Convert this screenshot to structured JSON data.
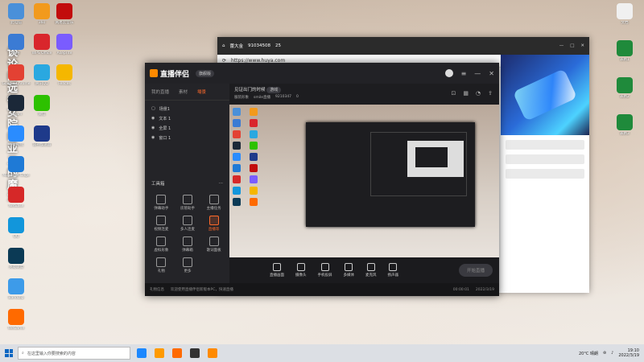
{
  "desktop": {
    "vertical_text": "谈论的远征女院的亚二的魔法",
    "icons_left": [
      {
        "label": "此电脑",
        "color": "#4a90d9"
      },
      {
        "label": "网络",
        "color": "#3b7bd4"
      },
      {
        "label": "Google Chrome",
        "color": "#e34133"
      },
      {
        "label": "Steam",
        "color": "#1b2838"
      },
      {
        "label": "百度网盘",
        "color": "#2a8cff"
      },
      {
        "label": "Microsoft Edge",
        "color": "#1f7ad6"
      },
      {
        "label": "NetEase",
        "color": "#d62828"
      },
      {
        "label": "QQ",
        "color": "#1296db"
      },
      {
        "label": "英雄联盟",
        "color": "#0b3a55"
      },
      {
        "label": "Bandizip",
        "color": "#3d9be9"
      },
      {
        "label": "WeGame",
        "color": "#ff6a00"
      }
    ],
    "icons_col2": [
      {
        "label": "360",
        "color": "#f29a1d"
      },
      {
        "label": "WPS Office",
        "color": "#d9262c"
      },
      {
        "label": "腾讯QQ",
        "color": "#2aa8e0"
      },
      {
        "label": "微信",
        "color": "#2dc100"
      },
      {
        "label": "雷神加速器",
        "color": "#1e3a8a"
      }
    ],
    "icons_col3": [
      {
        "label": "网易云音乐",
        "color": "#c20c0c"
      },
      {
        "label": "Aseprite",
        "color": "#7a5cff"
      },
      {
        "label": "Fences",
        "color": "#f5b700"
      }
    ],
    "icons_right": [
      {
        "label": "文档",
        "color": "#f0f0f0"
      },
      {
        "label": "表格1",
        "color": "#1f8a3b"
      },
      {
        "label": "表格2",
        "color": "#1f8a3b"
      },
      {
        "label": "表格3",
        "color": "#1f8a3b"
      }
    ]
  },
  "back_window": {
    "room_name": "蕾大金",
    "room_id": "91034508",
    "viewers": "25",
    "address": "https://www.huya.com"
  },
  "app": {
    "title": "直播伴侣",
    "version_badge": "旗舰版",
    "tabs": [
      "我的直播",
      "素材",
      "場景"
    ],
    "scenes": [
      "场景1",
      "文本 1",
      "全屏 1",
      "窗口 1"
    ],
    "tool_title": "工具箱",
    "tools": [
      "弹幕助手",
      "房管助手",
      "主播任务",
      "视频连麦",
      "多人连麦",
      "直播等",
      "虚拟形象",
      "弹幕箱",
      "歌词面板",
      "礼物",
      "更多"
    ],
    "room_title": "见证出门的时候",
    "room_tag": "游戏",
    "room_category": "服装形象",
    "room_sub": "smile直播",
    "room_num": "9210347",
    "room_fans": "0",
    "controls": [
      "直播画面",
      "摄像头",
      "手机投屏",
      "多媒体",
      "麦克风",
      "扬声器"
    ],
    "start_label": "开始直播",
    "status_left": "礼物信息",
    "status_mid": "欢迎使用直播伴侣新版本PC，快速直播",
    "status_time": "00:00:01",
    "status_date": "2022/3/19"
  },
  "taskbar": {
    "search_placeholder": "在这里输入你要搜索的内容",
    "weather": "20°C 晴朗",
    "time": "19:10",
    "date": "2022/3/19",
    "app_colors": [
      "#1c88ff",
      "#ff9a00",
      "#ff6a00",
      "#333",
      "#ff8a00"
    ]
  }
}
